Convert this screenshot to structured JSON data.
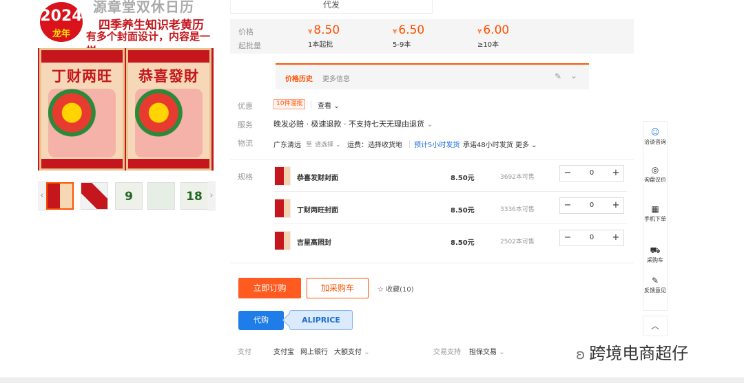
{
  "product_image": {
    "badge_year": "2024",
    "badge_sub": "龙年",
    "title_line1": "源章堂双休日历",
    "title_line2": "四季养生知识老黄历",
    "title_line3": "有多个封面设计，内容是一样",
    "cover_left": "丁财两旺",
    "cover_right": "恭喜發財",
    "thumb_3_text": "9",
    "thumb_5_text": "18"
  },
  "top_strip": {
    "text": "代发"
  },
  "price": {
    "price_label": "价格",
    "batch_label": "起批量",
    "currency": "¥",
    "tiers": [
      {
        "value": "8.50",
        "qty": "1本起批"
      },
      {
        "value": "6.50",
        "qty": "5-9本"
      },
      {
        "value": "6.00",
        "qty": "≥10本"
      }
    ]
  },
  "history": {
    "tab_active": "价格历史",
    "tab_more": "更多信息"
  },
  "promo": {
    "label": "优惠",
    "tag": "10件混批",
    "view": "查看"
  },
  "service": {
    "label": "服务",
    "text": "晚发必赔 · 极速退款 · 不支持七天无理由退货"
  },
  "logistics": {
    "label": "物流",
    "from": "广东清远",
    "to_word": "至",
    "select": "请选择",
    "freight": "运费：选择收货地",
    "eta": "预计5小时发货",
    "promise": "承诺48小时发货",
    "more": "更多"
  },
  "spec": {
    "label": "规格",
    "unit_price_suffix": "元",
    "items": [
      {
        "name": "恭喜发财封面",
        "price": "8.50元",
        "stock": "3692本可售",
        "qty": "0"
      },
      {
        "name": "丁财两旺封面",
        "price": "8.50元",
        "stock": "3336本可售",
        "qty": "0"
      },
      {
        "name": "吉星高照封",
        "price": "8.50元",
        "stock": "2502本可售",
        "qty": "0"
      }
    ]
  },
  "actions": {
    "order": "立即订购",
    "cart": "加采购车",
    "favorite": "收藏(10)",
    "proxy": "代购",
    "aliprice": "ALIPRICE"
  },
  "payment": {
    "label": "支付",
    "methods": [
      "支付宝",
      "网上银行",
      "大额支付"
    ],
    "trade_label": "交易支持",
    "trade_value": "担保交易"
  },
  "sidebar": {
    "items": [
      {
        "icon": "chat-icon",
        "label": "洽谈咨询"
      },
      {
        "icon": "bargain-icon",
        "label": "询盘议价"
      },
      {
        "icon": "qrcode-icon",
        "label": "手机下单"
      },
      {
        "icon": "cart-icon",
        "label": "采购车"
      },
      {
        "icon": "feedback-icon",
        "label": "反馈意见"
      }
    ]
  },
  "watermark": {
    "text": "跨境电商超仔"
  },
  "colors": {
    "accent": "#ff5000",
    "blue": "#1e7de8"
  }
}
